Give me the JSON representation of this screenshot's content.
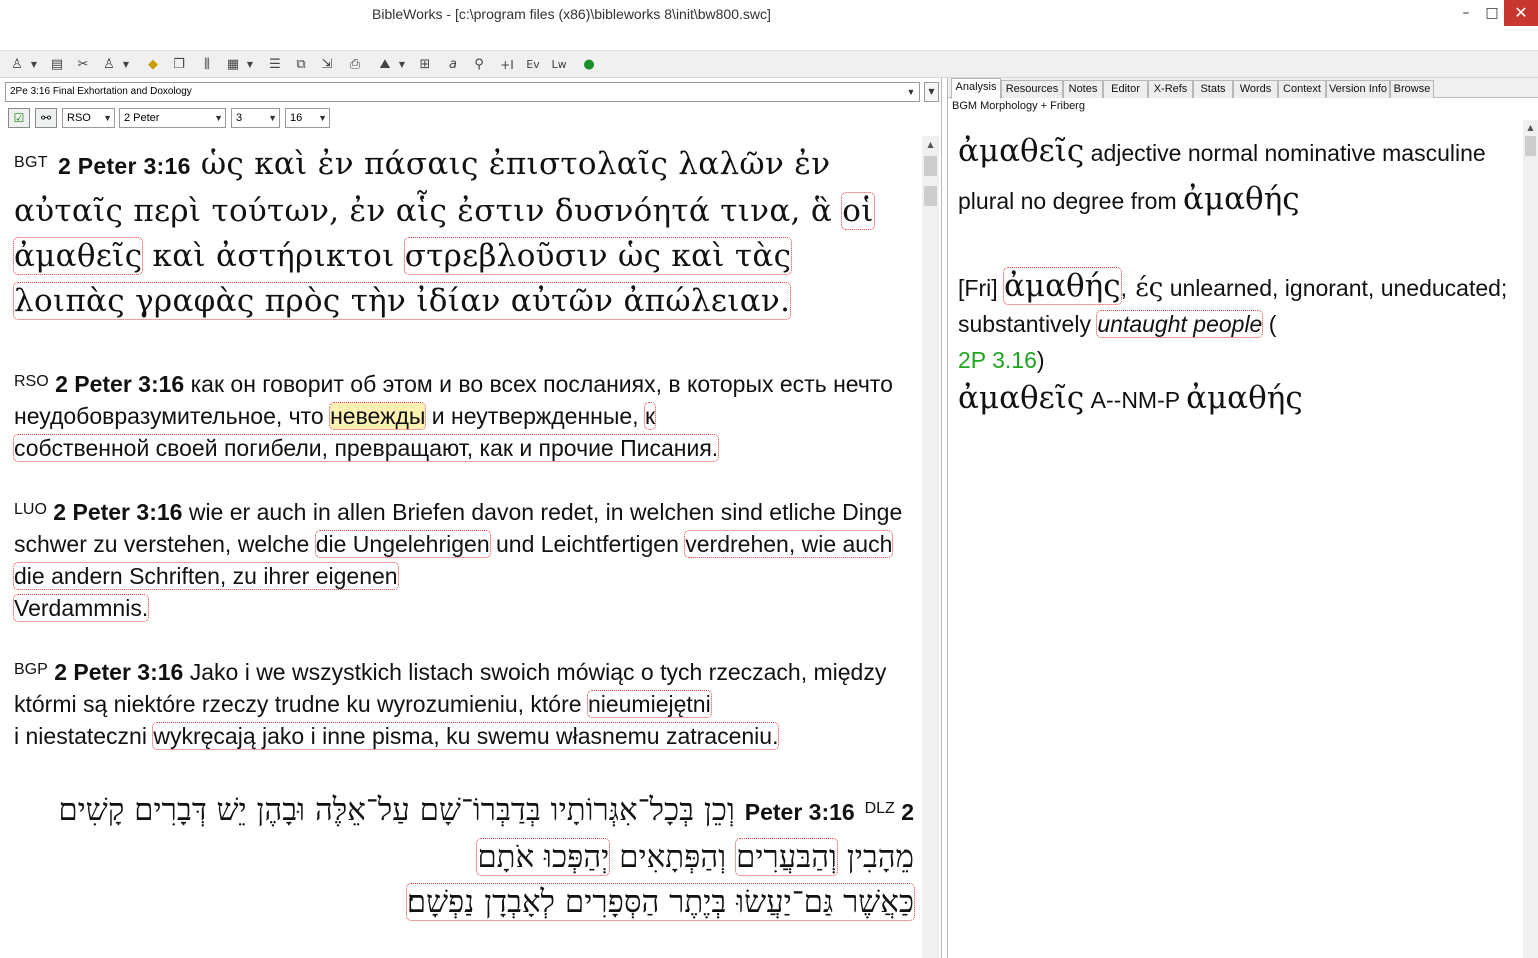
{
  "window": {
    "title": "BibleWorks - [c:\\program files (x86)\\bibleworks 8\\init\\bw800.swc]",
    "minimize": "–",
    "maximize": "□",
    "close": "✕"
  },
  "toolbar": {
    "icons": [
      "person-icon",
      "book-icon",
      "tools-icon",
      "person-icon",
      "gold-icon",
      "window-icon",
      "columns-icon",
      "grid-icon",
      "list-icon",
      "copy-icon",
      "export-icon",
      "print-icon",
      "map-icon",
      "layout-icon",
      "word-icon",
      "search-icon",
      "plus-icon",
      "ev-icon",
      "lw-icon",
      "globe-icon"
    ],
    "ev_label": "Ev",
    "lw_label": "Lw",
    "plus_label": "+I"
  },
  "left": {
    "header_text": "2Pe 3:16 Final Exhortation and Doxology",
    "version_select": "RSO",
    "book_select": "2 Peter",
    "chapter_select": "3",
    "verse_select": "16",
    "verses": {
      "bgt": {
        "version": "BGT",
        "ref": "2 Peter 3:16",
        "t1": " ὡς καὶ ἐν πάσαις ἐπιστολαῖς λαλῶν ἐν αὐταῖς περὶ τούτων, ἐν αἷς ἐστιν δυσνόητά τινα, ἃ ",
        "h1": "οἱ ἀμαθεῖς",
        "t2": " καὶ ἀστήρικτοι ",
        "h2": "στρεβλοῦσιν ὡς καὶ τὰς",
        "h3": "λοιπὰς γραφὰς πρὸς τὴν ἰδίαν αὐτῶν ἀπώλειαν."
      },
      "rso": {
        "version": "RSO",
        "ref": "2 Peter 3:16",
        "t1": " как он говорит об этом и во всех посланиях, в которых есть нечто неудобовразумительное, что ",
        "h1": "невежды",
        "t2": " и неутвержденные, ",
        "h2": "к",
        "h3": "собственной своей погибели, превращают, как и прочие Писания."
      },
      "luo": {
        "version": "LUO",
        "ref": "2 Peter 3:16",
        "t1": " wie er auch in allen Briefen davon redet, in welchen sind etliche Dinge schwer zu verstehen, welche ",
        "h1": "die Ungelehrigen",
        "t2": " und Leichtfertigen ",
        "h2": "verdrehen, wie auch die andern Schriften, zu ihrer eigenen",
        "h3": "Verdammnis."
      },
      "bgp": {
        "version": "BGP",
        "ref": "2 Peter 3:16",
        "t1": " Jako i we wszystkich listach swoich mówiąc o tych rzeczach, między którmi są niektóre rzeczy trudne ku wyrozumieniu, które ",
        "h1": "nieumiejętni ",
        "t2": " i niestateczni ",
        "h2": "wykręcają jako i inne pisma, ku swemu własnemu zatraceniu."
      },
      "dlz": {
        "version": "DLZ",
        "ref": "2 Peter 3:16",
        "t1": " וְכֵן בְּכָל־אִגְּרוֹתָיו בְּדַבְּרוֹ־שָׁם עַל־אֵלֶּה וּבָהֶן יֵשׁ דְּבָרִים קָשִׁים מֵהָבִין ",
        "h1": "וְהַבּעֲרִים",
        "t2": " וְהַפְּתָאִים ",
        "h2": "יְהַפְּכוּ אֹתָם",
        "h3": "כַּאֲשֶׁר גַּם־יַעֲשׂוּ בְּיֶתֶר הַסְּפָרִים לְאָבְדָן נַפְשָׁם׃"
      }
    }
  },
  "right": {
    "tabs": [
      "Analysis",
      "Resources",
      "Notes",
      "Editor",
      "X-Refs",
      "Stats",
      "Words",
      "Context",
      "Version Info",
      "Browse"
    ],
    "active_tab": "Analysis",
    "module": "BGM Morphology + Friberg",
    "parse": {
      "word": "ἀμαθεῖς",
      "desc": " adjective normal nominative masculine plural no degree from ",
      "lemma": "ἀμαθής"
    },
    "lexicon": {
      "source": "[Fri]",
      "headword": "ἀμαθής",
      "sep": ",",
      "ending": " ές",
      "gloss": " unlearned, ignorant, uneducated; substantively ",
      "italic": "untaught people",
      "paren_open": " (",
      "ref": "2P 3.16",
      "paren_close": ")"
    },
    "morph": {
      "word": "ἀμαθεῖς",
      "code": "A--NM-P",
      "lemma": "ἀμαθής"
    }
  },
  "colors": {
    "highlight_outline": "#e23a3a",
    "highlight_fill": "#fff2b3",
    "reference_green": "#1ea51e",
    "close_button": "#c7372f"
  }
}
